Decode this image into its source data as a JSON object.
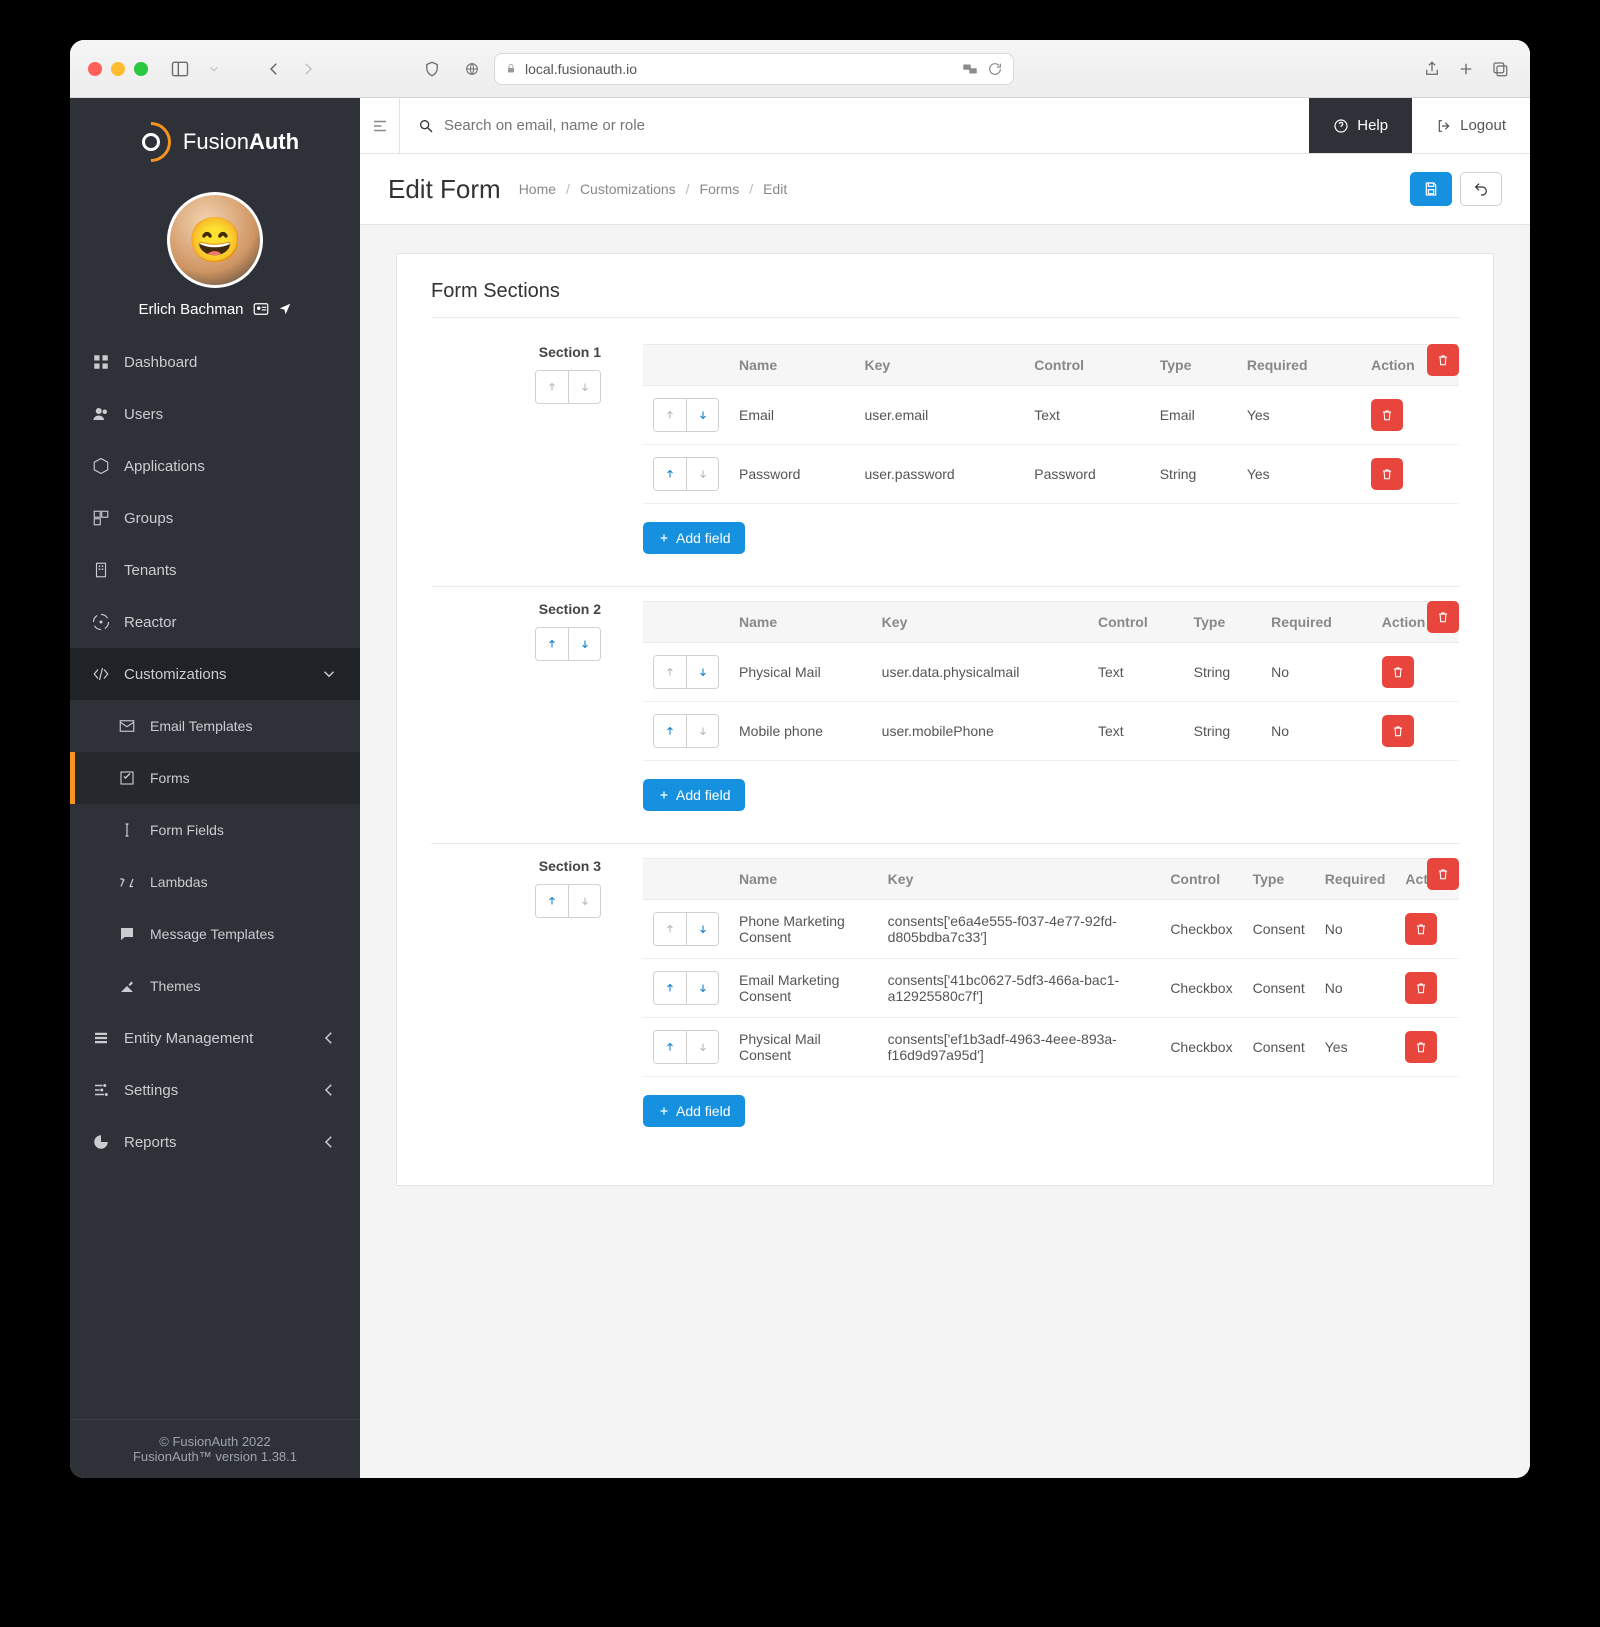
{
  "browser": {
    "host": "local.fusionauth.io"
  },
  "brand": {
    "logo_a": "Fusion",
    "logo_b": "Auth"
  },
  "user": {
    "name": "Erlich Bachman"
  },
  "nav": {
    "dashboard": "Dashboard",
    "users": "Users",
    "applications": "Applications",
    "groups": "Groups",
    "tenants": "Tenants",
    "reactor": "Reactor",
    "customizations": "Customizations",
    "email_templates": "Email Templates",
    "forms": "Forms",
    "form_fields": "Form Fields",
    "lambdas": "Lambdas",
    "message_templates": "Message Templates",
    "themes": "Themes",
    "entity_management": "Entity Management",
    "settings": "Settings",
    "reports": "Reports"
  },
  "topbar": {
    "search_placeholder": "Search on email, name or role",
    "help": "Help",
    "logout": "Logout"
  },
  "page": {
    "title": "Edit Form",
    "crumbs": [
      "Home",
      "Customizations",
      "Forms",
      "Edit"
    ]
  },
  "card": {
    "heading": "Form Sections",
    "columns": {
      "name": "Name",
      "key": "Key",
      "control": "Control",
      "type": "Type",
      "required": "Required",
      "action": "Action"
    },
    "add_field": "Add field",
    "sections": [
      {
        "title": "Section 1",
        "move_up_disabled": true,
        "move_down_disabled": true,
        "fields": [
          {
            "name": "Email",
            "key": "user.email",
            "control": "Text",
            "type": "Email",
            "required": "Yes",
            "up_disabled": true,
            "down_disabled": false
          },
          {
            "name": "Password",
            "key": "user.password",
            "control": "Password",
            "type": "String",
            "required": "Yes",
            "up_disabled": false,
            "down_disabled": true
          }
        ]
      },
      {
        "title": "Section 2",
        "move_up_disabled": false,
        "move_down_disabled": false,
        "fields": [
          {
            "name": "Physical Mail",
            "key": "user.data.physicalmail",
            "control": "Text",
            "type": "String",
            "required": "No",
            "up_disabled": true,
            "down_disabled": false
          },
          {
            "name": "Mobile phone",
            "key": "user.mobilePhone",
            "control": "Text",
            "type": "String",
            "required": "No",
            "up_disabled": false,
            "down_disabled": true
          }
        ]
      },
      {
        "title": "Section 3",
        "move_up_disabled": false,
        "move_down_disabled": true,
        "fields": [
          {
            "name": "Phone Marketing Consent",
            "key": "consents['e6a4e555-f037-4e77-92fd-d805bdba7c33']",
            "control": "Checkbox",
            "type": "Consent",
            "required": "No",
            "up_disabled": true,
            "down_disabled": false
          },
          {
            "name": "Email Marketing Consent",
            "key": "consents['41bc0627-5df3-466a-bac1-a12925580c7f']",
            "control": "Checkbox",
            "type": "Consent",
            "required": "No",
            "up_disabled": false,
            "down_disabled": false
          },
          {
            "name": "Physical Mail Consent",
            "key": "consents['ef1b3adf-4963-4eee-893a-f16d9d97a95d']",
            "control": "Checkbox",
            "type": "Consent",
            "required": "Yes",
            "up_disabled": false,
            "down_disabled": true
          }
        ]
      }
    ]
  },
  "footer": {
    "copyright": "© FusionAuth 2022",
    "version": "FusionAuth™ version 1.38.1"
  }
}
